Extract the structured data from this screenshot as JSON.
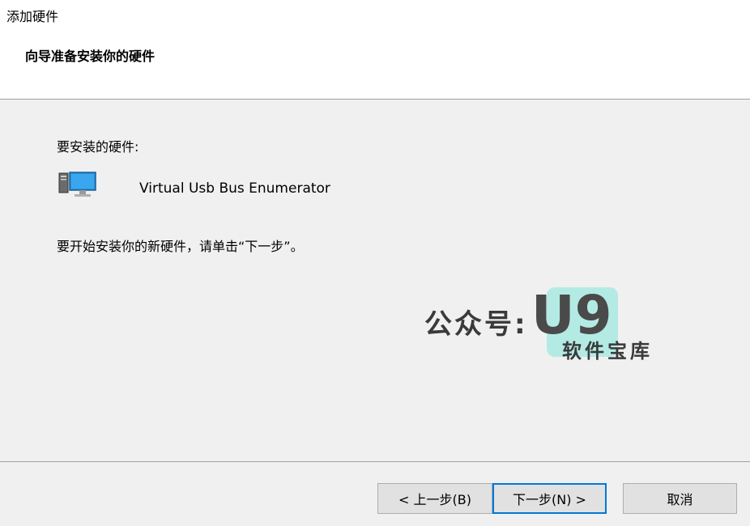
{
  "window": {
    "title": "添加硬件"
  },
  "header": {
    "heading": "向导准备安装你的硬件"
  },
  "content": {
    "hardware_label": "要安装的硬件:",
    "device": {
      "name": "Virtual Usb Bus Enumerator",
      "icon": "computer-hardware-icon"
    },
    "instruction": "要开始安装你的新硬件，请单击“下一步”。"
  },
  "watermark": {
    "prefix": "公众号:",
    "logo": "U9",
    "subtitle": "软件宝库",
    "accent": "#a8eae2"
  },
  "footer": {
    "back_label": "< 上一步(B)",
    "next_label": "下一步(N) >",
    "cancel_label": "取消"
  },
  "colors": {
    "focus_border": "#0078d7",
    "button_bg": "#e1e1e1",
    "panel_bg": "#f0f0f0"
  }
}
